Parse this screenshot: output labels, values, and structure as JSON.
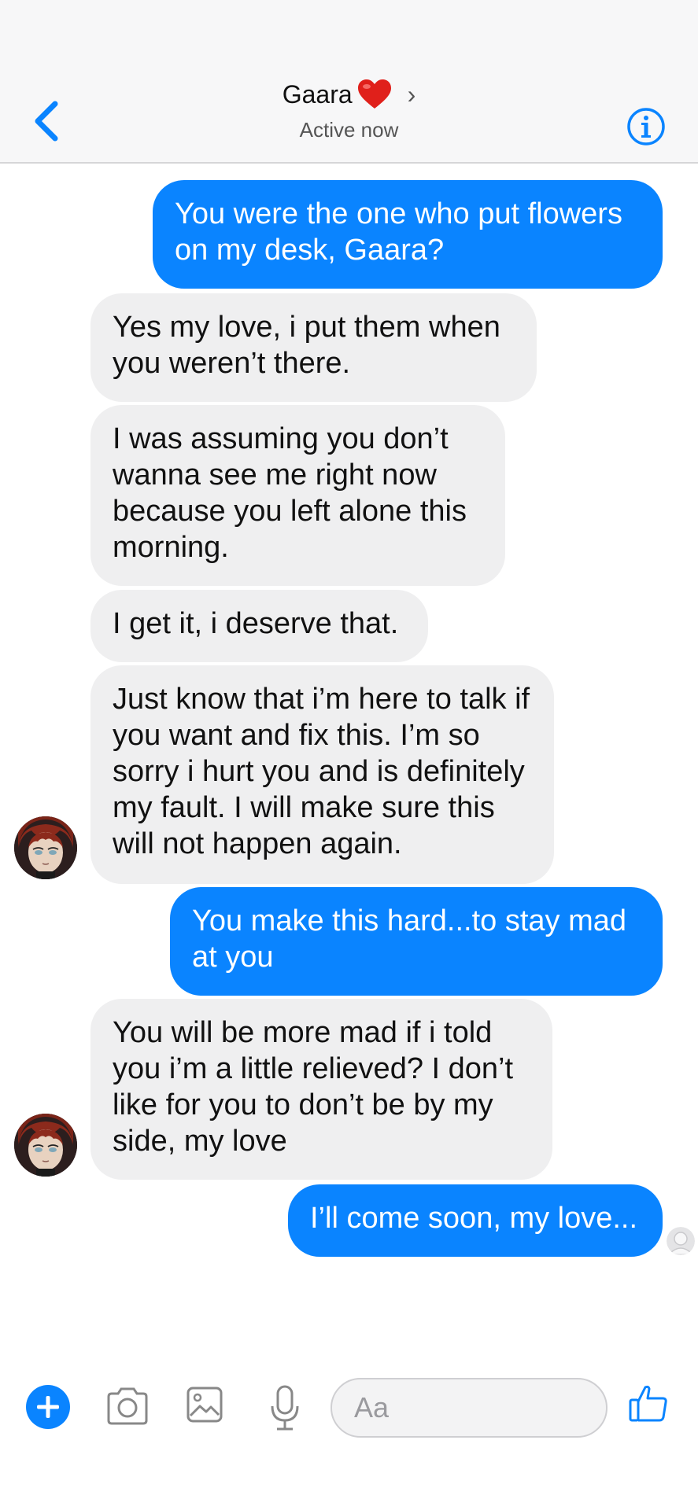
{
  "header": {
    "contact_name": "Gaara",
    "status": "Active now"
  },
  "messages": [
    {
      "side": "out",
      "text": "You were the one who put flowers on my desk, Gaara?"
    },
    {
      "side": "in",
      "text": "Yes my love, i put them when you weren’t there."
    },
    {
      "side": "in",
      "text": "I was assuming you don’t wanna see me right now because you left alone this morning."
    },
    {
      "side": "in",
      "text": "I get it, i deserve that."
    },
    {
      "side": "in",
      "text": "Just know that i’m here to talk if you want and fix this. I’m so sorry i hurt you and is definitely my fault. I will make sure this will not happen again."
    },
    {
      "side": "out",
      "text": "You make this hard...to stay mad at you"
    },
    {
      "side": "in",
      "text": "You will be more mad if i told you i’m a little relieved? I don’t like for you to don’t be by my side, my love"
    },
    {
      "side": "out",
      "text": "I’ll come soon, my love..."
    }
  ],
  "composer": {
    "placeholder": "Aa"
  },
  "colors": {
    "accent": "#0a84ff",
    "incoming_bubble": "#efeff0",
    "heart": "#e0201b"
  },
  "icons": [
    "back-arrow-icon",
    "heart-icon",
    "chevron-right-icon",
    "info-icon",
    "plus-icon",
    "camera-icon",
    "gallery-icon",
    "microphone-icon",
    "like-icon"
  ]
}
